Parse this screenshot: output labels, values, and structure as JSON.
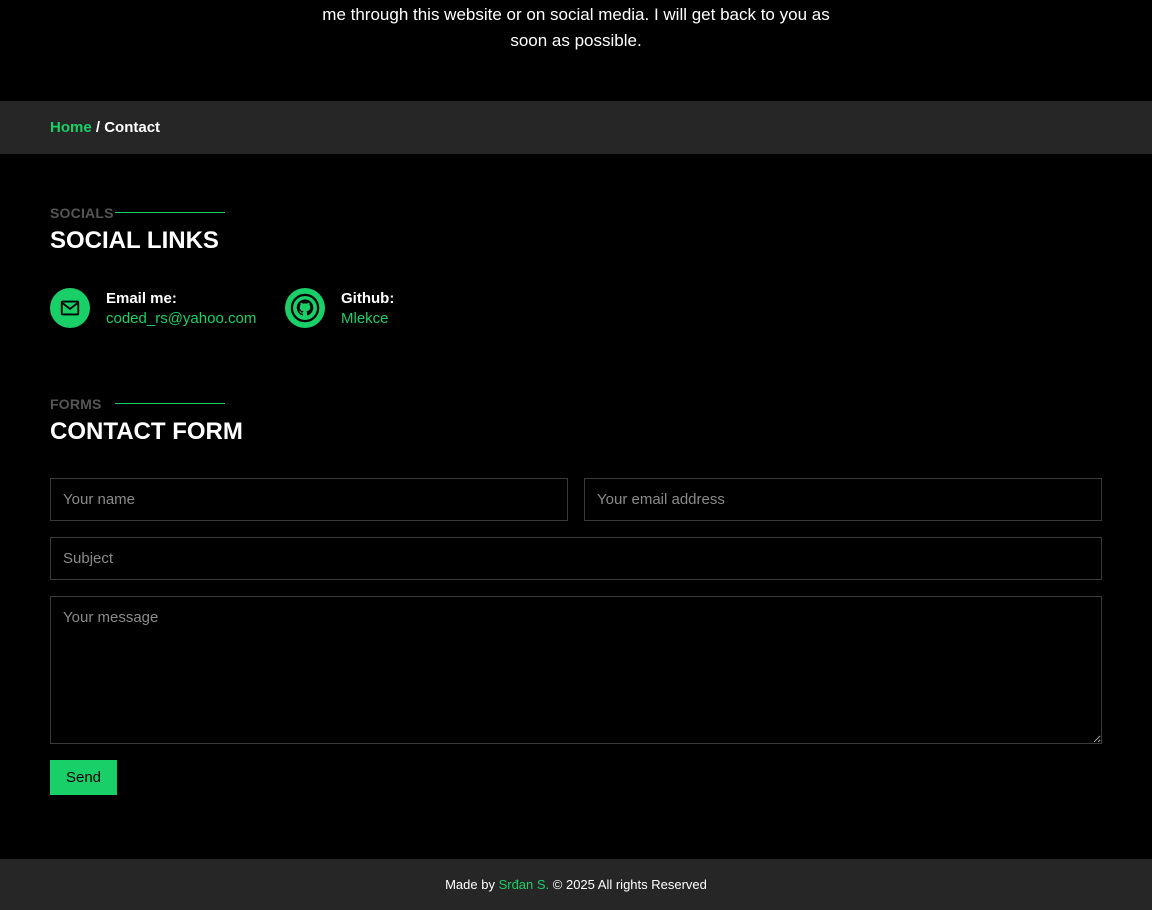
{
  "hero": {
    "line1": "me through this website or on social media. I will get back to you as",
    "line2": "soon as possible."
  },
  "breadcrumb": {
    "home": "Home",
    "separator": " / ",
    "current": "Contact"
  },
  "socials_section": {
    "kicker": "SOCIALS",
    "title": "SOCIAL LINKS",
    "items": [
      {
        "icon": "mail-icon",
        "label": "Email me:",
        "value": "coded_rs@yahoo.com"
      },
      {
        "icon": "github-icon",
        "label": "Github:",
        "value": "Mlekce"
      }
    ]
  },
  "form_section": {
    "kicker": "FORMS",
    "title": "CONTACT FORM",
    "name_placeholder": "Your name",
    "email_placeholder": "Your email address",
    "subject_placeholder": "Subject",
    "message_placeholder": "Your message",
    "send_label": "Send"
  },
  "footer": {
    "prefix": "Made by ",
    "author": "Srđan S.",
    "suffix": " © 2025 All rights Reserved"
  },
  "colors": {
    "accent": "#19cf67",
    "bar_background": "#262626",
    "page_background": "#000000"
  }
}
